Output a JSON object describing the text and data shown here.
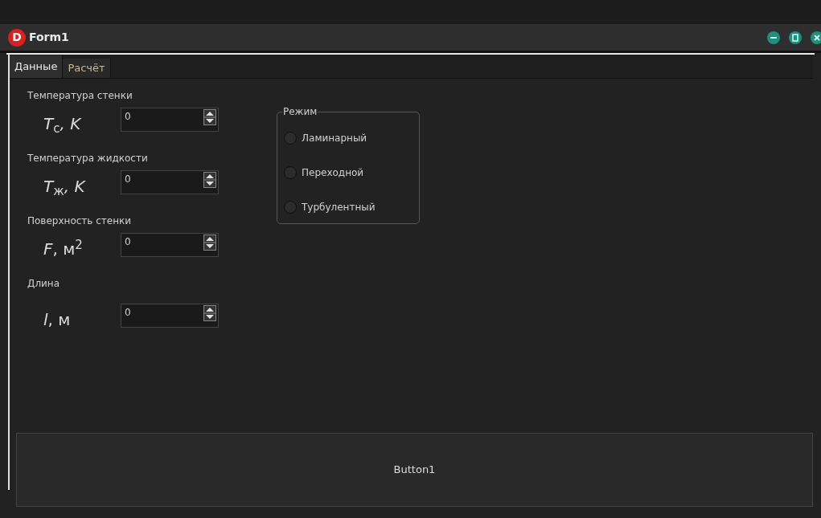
{
  "window": {
    "title": "Form1",
    "logo": "D"
  },
  "tabs": [
    {
      "label": "Данные",
      "selected": true
    },
    {
      "label": "Расчёт",
      "selected": false
    }
  ],
  "inputs": [
    {
      "label": "Температура стенки",
      "symbol": "*T*$_{с}$*, K*",
      "value": "0"
    },
    {
      "label": "Температура жидкости",
      "symbol": "*T*$_{ж}$*, K*",
      "value": "0"
    },
    {
      "label": "Поверхность стенки",
      "symbol": "*F*, м$^{2}$",
      "value": "0"
    },
    {
      "label": "Длина",
      "symbol": "*l*, м",
      "value": "0"
    }
  ],
  "mode_group": {
    "title": "Режим",
    "options": [
      {
        "label": "Ламинарный",
        "selected": false
      },
      {
        "label": "Переходной",
        "selected": false
      },
      {
        "label": "Турбулентный",
        "selected": false
      }
    ]
  },
  "button": {
    "label": "Button1"
  }
}
